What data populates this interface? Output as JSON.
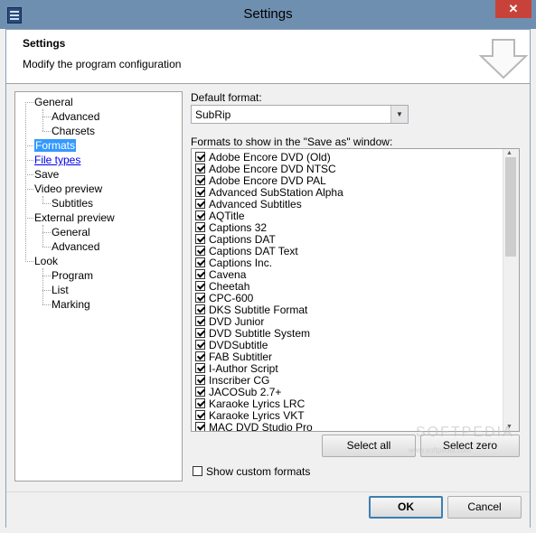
{
  "window": {
    "title": "Settings",
    "close_glyph": "✕"
  },
  "header": {
    "title": "Settings",
    "subtitle": "Modify the program configuration"
  },
  "tree": {
    "nodes": [
      {
        "label": "General"
      },
      {
        "label": "Advanced"
      },
      {
        "label": "Charsets"
      },
      {
        "label": "Formats"
      },
      {
        "label": "File types"
      },
      {
        "label": "Save"
      },
      {
        "label": "Video preview"
      },
      {
        "label": "Subtitles"
      },
      {
        "label": "External preview"
      },
      {
        "label": "General"
      },
      {
        "label": "Advanced"
      },
      {
        "label": "Look"
      },
      {
        "label": "Program"
      },
      {
        "label": "List"
      },
      {
        "label": "Marking"
      }
    ]
  },
  "default_format": {
    "label": "Default format:",
    "value": "SubRip"
  },
  "formats_list": {
    "label": "Formats to show in the \"Save as\" window:",
    "items": [
      {
        "label": "Adobe Encore DVD (Old)",
        "checked": true
      },
      {
        "label": "Adobe Encore DVD NTSC",
        "checked": true
      },
      {
        "label": "Adobe Encore DVD PAL",
        "checked": true
      },
      {
        "label": "Advanced SubStation Alpha",
        "checked": true
      },
      {
        "label": "Advanced Subtitles",
        "checked": true
      },
      {
        "label": "AQTitle",
        "checked": true
      },
      {
        "label": "Captions 32",
        "checked": true
      },
      {
        "label": "Captions DAT",
        "checked": true
      },
      {
        "label": "Captions DAT Text",
        "checked": true
      },
      {
        "label": "Captions Inc.",
        "checked": true
      },
      {
        "label": "Cavena",
        "checked": true
      },
      {
        "label": "Cheetah",
        "checked": true
      },
      {
        "label": "CPC-600",
        "checked": true
      },
      {
        "label": "DKS Subtitle Format",
        "checked": true
      },
      {
        "label": "DVD Junior",
        "checked": true
      },
      {
        "label": "DVD Subtitle System",
        "checked": true
      },
      {
        "label": "DVDSubtitle",
        "checked": true
      },
      {
        "label": "FAB Subtitler",
        "checked": true
      },
      {
        "label": "I-Author Script",
        "checked": true
      },
      {
        "label": "Inscriber CG",
        "checked": true
      },
      {
        "label": "JACOSub 2.7+",
        "checked": true
      },
      {
        "label": "Karaoke Lyrics LRC",
        "checked": true
      },
      {
        "label": "Karaoke Lyrics VKT",
        "checked": true
      },
      {
        "label": "MAC DVD Studio Pro",
        "checked": true
      }
    ]
  },
  "buttons": {
    "select_all": "Select all",
    "select_zero": "Select zero",
    "ok": "OK",
    "cancel": "Cancel"
  },
  "show_custom": {
    "label": "Show custom formats",
    "checked": false
  },
  "watermark": {
    "text": "SOFTPEDIA",
    "url": "www.softpedia.com"
  }
}
